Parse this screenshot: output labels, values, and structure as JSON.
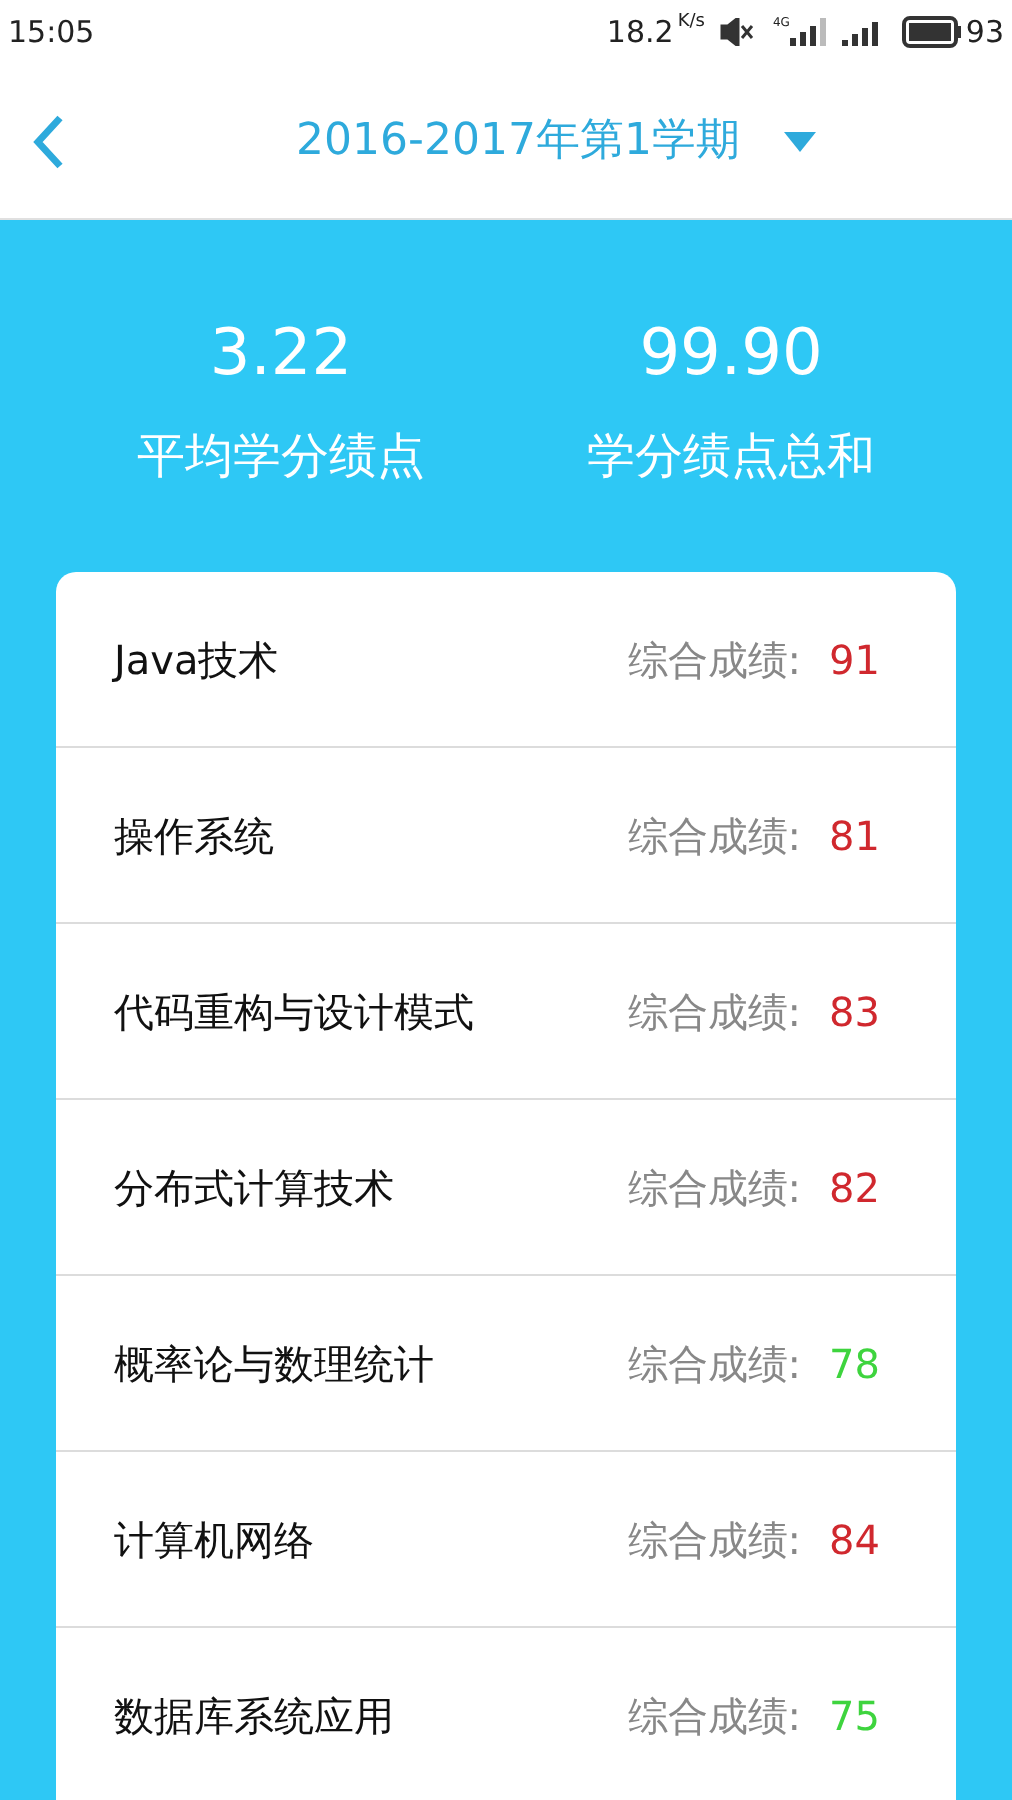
{
  "status_bar": {
    "time": "15:05",
    "speed": "18.2",
    "speed_unit": "K/s",
    "network": "4G",
    "battery": "93"
  },
  "header": {
    "title": "2016-2017年第1学期"
  },
  "summary": [
    {
      "value": "3.22",
      "label": "平均学分绩点"
    },
    {
      "value": "99.90",
      "label": "学分绩点总和"
    }
  ],
  "courses": [
    {
      "name": "Java技术",
      "score_label": "综合成绩:",
      "score": "91",
      "color": "#d0282e"
    },
    {
      "name": "操作系统",
      "score_label": "综合成绩:",
      "score": "81",
      "color": "#d0282e"
    },
    {
      "name": "代码重构与设计模式",
      "score_label": "综合成绩:",
      "score": "83",
      "color": "#d0282e"
    },
    {
      "name": "分布式计算技术",
      "score_label": "综合成绩:",
      "score": "82",
      "color": "#d0282e"
    },
    {
      "name": "概率论与数理统计",
      "score_label": "综合成绩:",
      "score": "78",
      "color": "#3ed43e"
    },
    {
      "name": "计算机网络",
      "score_label": "综合成绩:",
      "score": "84",
      "color": "#d0282e"
    },
    {
      "name": "数据库系统应用",
      "score_label": "综合成绩:",
      "score": "75",
      "color": "#3ed43e"
    }
  ]
}
